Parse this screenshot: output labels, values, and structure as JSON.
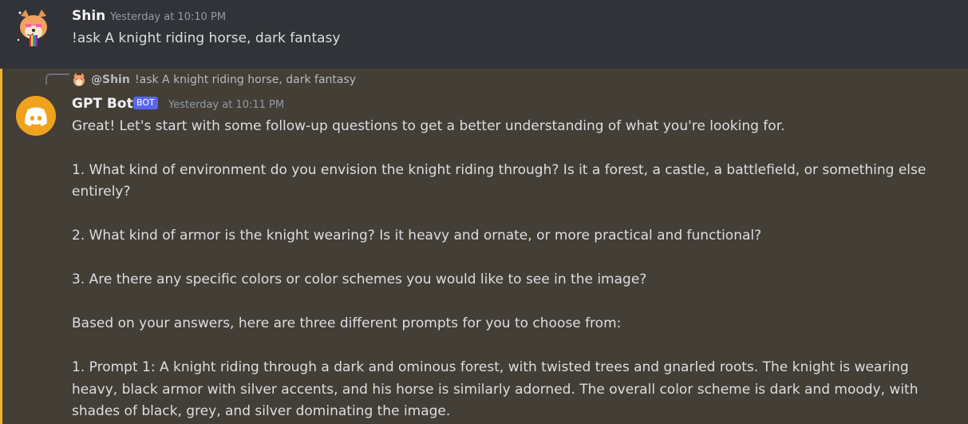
{
  "message1": {
    "author": "Shin",
    "timestamp": "Yesterday at 10:10 PM",
    "content": "!ask A knight riding horse, dark fantasy",
    "avatar_icon": "shiba-dog-avatar"
  },
  "message2": {
    "reply": {
      "mention": "@Shin",
      "text": "!ask A knight riding horse, dark fantasy"
    },
    "author": "GPT Bot",
    "badge": "BOT",
    "timestamp": "Yesterday at 10:11 PM",
    "avatar_icon": "discord-logo-icon",
    "avatar_color": "#f0a11d",
    "mention_highlight_color": "#f0b232",
    "lines": [
      "Great! Let's start with some follow-up questions to get a better understanding of what you're looking for.",
      "1. What kind of environment do you envision the knight riding through? Is it a forest, a castle, a battlefield, or something else",
      "entirely?",
      "2. What kind of armor is the knight wearing? Is it heavy and ornate, or more practical and functional?",
      "3. Are there any specific colors or color schemes you would like to see in the image?",
      "Based on your answers, here are three different prompts for you to choose from:",
      "1. Prompt 1: A knight riding through a dark and ominous forest, with twisted trees and gnarled roots. The knight is wearing",
      "heavy, black armor with silver accents, and his horse is similarly adorned. The overall color scheme is dark and moody, with",
      "shades of black, grey, and silver dominating the image."
    ]
  }
}
